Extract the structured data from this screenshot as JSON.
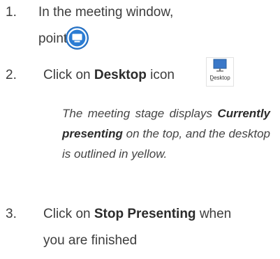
{
  "steps": [
    {
      "num": "1.",
      "line1": "In the meeting window,",
      "line2": "point to"
    },
    {
      "num": "2.",
      "pre": "Click on ",
      "bold": "Desktop",
      "post": " icon"
    },
    {
      "num": "3.",
      "pre": "Click on ",
      "bold": "Stop Presenting",
      "post": " when",
      "line2": "you are finished"
    }
  ],
  "note": {
    "p1": "The meeting stage displays ",
    "b": "Currently presenting",
    "p2": " on the top, and the desktop is outlined in yellow."
  },
  "desktop_icon_label": "Desktop",
  "colors": {
    "present_icon": "#2b7cd3",
    "desktop_screen": "#3a78c8"
  }
}
